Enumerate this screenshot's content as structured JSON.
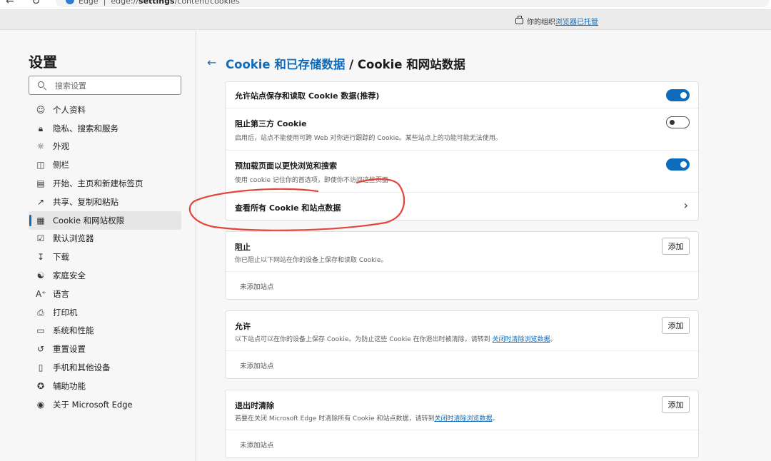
{
  "browser": {
    "tab_name": "Edge",
    "url_prefix": "edge://",
    "url_bold": "settings",
    "url_suffix": "/content/cookies"
  },
  "managed": {
    "text": "你的组织",
    "link": "浏览器已托管"
  },
  "sidebar": {
    "title": "设置",
    "search_placeholder": "搜索设置",
    "items": [
      {
        "label": "个人资料",
        "icon": "profile-icon"
      },
      {
        "label": "隐私、搜索和服务",
        "icon": "lock-icon"
      },
      {
        "label": "外观",
        "icon": "palette-icon"
      },
      {
        "label": "侧栏",
        "icon": "sidebar-icon"
      },
      {
        "label": "开始、主页和新建标签页",
        "icon": "home-icon"
      },
      {
        "label": "共享、复制和粘贴",
        "icon": "share-icon"
      },
      {
        "label": "Cookie 和网站权限",
        "icon": "site-permissions-icon",
        "active": true
      },
      {
        "label": "默认浏览器",
        "icon": "default-browser-icon"
      },
      {
        "label": "下载",
        "icon": "download-icon"
      },
      {
        "label": "家庭安全",
        "icon": "family-icon"
      },
      {
        "label": "语言",
        "icon": "language-icon"
      },
      {
        "label": "打印机",
        "icon": "printer-icon"
      },
      {
        "label": "系统和性能",
        "icon": "laptop-icon"
      },
      {
        "label": "重置设置",
        "icon": "reset-icon"
      },
      {
        "label": "手机和其他设备",
        "icon": "phone-icon"
      },
      {
        "label": "辅助功能",
        "icon": "accessibility-icon"
      },
      {
        "label": "关于 Microsoft Edge",
        "icon": "edge-logo-icon"
      }
    ]
  },
  "main": {
    "breadcrumb": "Cookie 和已存储数据",
    "separator": " / ",
    "title": "Cookie 和网站数据",
    "settings": {
      "allow_title": "允许站点保存和读取 Cookie 数据(推荐)",
      "allow_on": true,
      "block3p_title": "阻止第三方 Cookie",
      "block3p_desc": "启用后，站点不能使用可跨 Web 对你进行跟踪的 Cookie。某些站点上的功能可能无法使用。",
      "block3p_on": false,
      "preload_title": "预加载页面以更快浏览和搜索",
      "preload_desc": "使用 cookie 记住你的首选项，即使你不访问这些页面",
      "preload_on": true,
      "view_all": "查看所有 Cookie 和站点数据"
    },
    "block": {
      "title": "阻止",
      "desc": "你已阻止以下网站在你的设备上保存和读取 Cookie。",
      "add": "添加",
      "empty": "未添加站点"
    },
    "allow": {
      "title": "允许",
      "desc": "以下站点可以在你的设备上保存 Cookie。为防止这些 Cookie 在你退出时被清除，请转到 ",
      "link": "关闭时清除浏览数据",
      "desc_end": "。",
      "add": "添加",
      "empty": "未添加站点"
    },
    "clear_on_exit": {
      "title": "退出时清除",
      "desc": "若要在关闭 Microsoft Edge 时清除所有 Cookie 和站点数据，请转到",
      "link": "关闭时清除浏览数据",
      "desc_end": "。",
      "add": "添加",
      "empty": "未添加站点"
    }
  },
  "colors": {
    "accent": "#0f6cbd",
    "annotation": "#e2463a"
  }
}
